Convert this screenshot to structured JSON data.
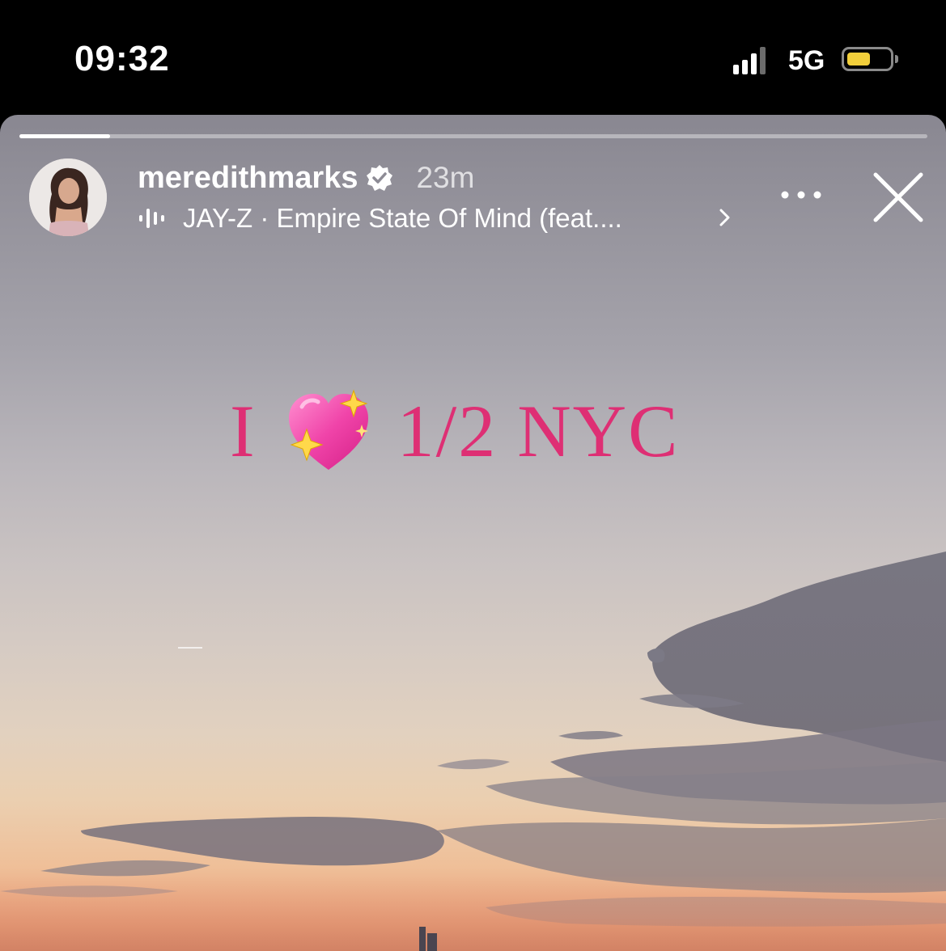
{
  "status_bar": {
    "time": "09:32",
    "network": "5G",
    "signal_bars_active": 3,
    "signal_bars_total": 4,
    "battery_level": 0.55,
    "battery_color": "#f2cf3b"
  },
  "story": {
    "progress": 0.1,
    "username": "meredithmarks",
    "verified": true,
    "timestamp": "23m",
    "music": "JAY-Z · Empire State Of Mind (feat....",
    "caption": {
      "left": "I",
      "emoji": "sparkling-heart",
      "right": "1/2 NYC",
      "color": "#de2f74"
    }
  }
}
